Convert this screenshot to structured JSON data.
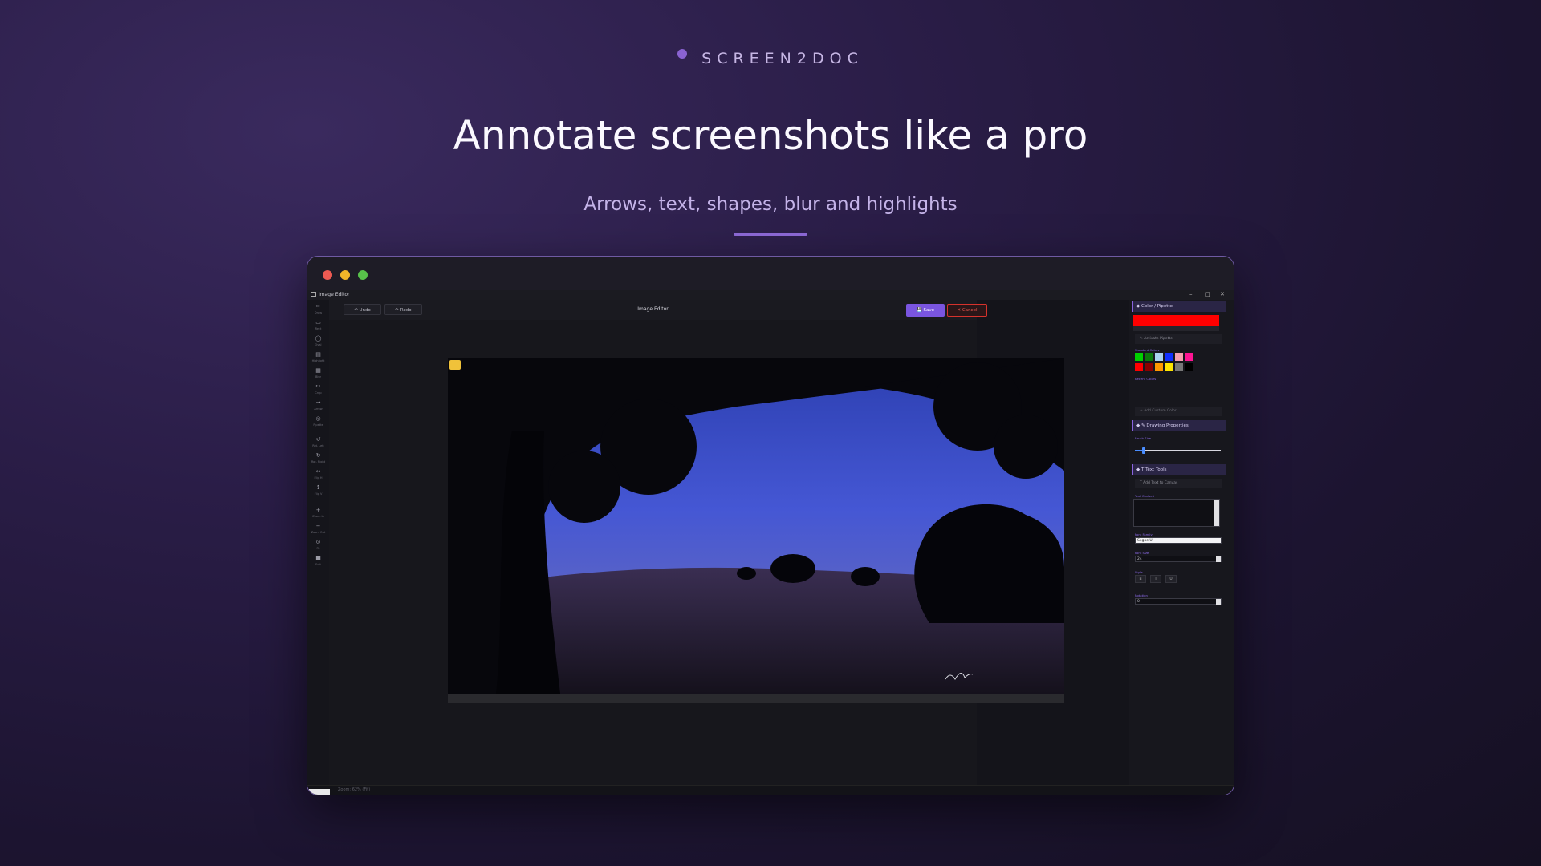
{
  "hero": {
    "brand": "SCREEN2DOC",
    "headline": "Annotate screenshots like a pro",
    "subline": "Arrows, text, shapes, blur and highlights"
  },
  "window": {
    "title": "Image Editor",
    "controls": {
      "minimize": "–",
      "maximize": "□",
      "close": "✕"
    }
  },
  "toolbar": {
    "undo": "↶ Undo",
    "redo": "↷ Redo",
    "title": "Image Editor",
    "save": "💾 Save",
    "cancel": "✕ Cancel"
  },
  "sidebar": {
    "tools": [
      {
        "icon": "✏",
        "label": "Draw"
      },
      {
        "icon": "▭",
        "label": "Rect"
      },
      {
        "icon": "◯",
        "label": "Oval"
      },
      {
        "icon": "▤",
        "label": "Highlight"
      },
      {
        "icon": "▦",
        "label": "Blur"
      },
      {
        "icon": "✂",
        "label": "Crop"
      },
      {
        "icon": "→",
        "label": "Arrow"
      },
      {
        "icon": "◎",
        "label": "Pipette"
      },
      {
        "icon": "↺",
        "label": "Rot. Left"
      },
      {
        "icon": "↻",
        "label": "Rot. Right"
      },
      {
        "icon": "↔",
        "label": "Flip H"
      },
      {
        "icon": "↕",
        "label": "Flip V"
      },
      {
        "icon": "+",
        "label": "Zoom In"
      },
      {
        "icon": "−",
        "label": "Zoom Out"
      },
      {
        "icon": "⊙",
        "label": "Fit"
      },
      {
        "icon": "■",
        "label": "Edit"
      }
    ]
  },
  "status": {
    "text": "Zoom: 62% (Fit)"
  },
  "panel": {
    "color_section": "Color / Pipette",
    "current_color": "#ff0000",
    "activate_pipette": "Activate Pipette",
    "standard_colors_label": "Standard Colors",
    "standard_colors": [
      "#00d000",
      "#0a7a0a",
      "#a9d3ef",
      "#1030ff",
      "#f6a0b0",
      "#ff1493",
      "#ff0000",
      "#8b0000",
      "#ff9900",
      "#ffe600",
      "#777777",
      "#000000"
    ],
    "recent_colors_label": "Recent Colors",
    "add_custom_color": "+ Add Custom Color...",
    "drawing_section": "Drawing Properties",
    "brush_size_label": "Brush Size",
    "brush_size_fraction": 0.1,
    "text_section": "Text Tools",
    "add_text": "T  Add Text to Canvas",
    "text_content_label": "Text Content",
    "font_family_label": "Font Family",
    "font_family": "Segoe UI",
    "font_size_label": "Font Size",
    "font_size": "24",
    "style_label": "Style",
    "styles": [
      "B",
      "I",
      "U"
    ],
    "rotation_label": "Rotation",
    "rotation": "0"
  }
}
